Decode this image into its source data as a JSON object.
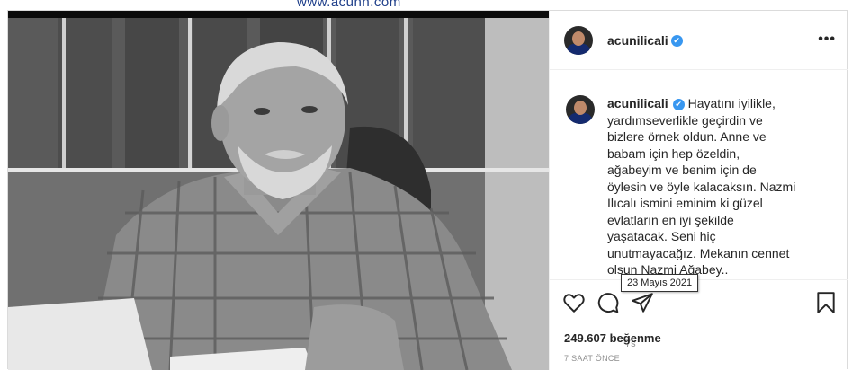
{
  "watermark": "www.acunn.com",
  "post": {
    "author": {
      "username": "acunilicali",
      "verified": true,
      "verified_icon": "verified-badge-icon"
    },
    "more_icon": "more-options-icon",
    "more_label": "•••",
    "caption": "Hayatını iyilikle, yardımseverlikle geçirdin ve bizlere örnek oldun. Anne ve babam için hep özeldin, ağabeyim ve benim için de öylesin ve öyle kalacaksın. Nazmi Ilıcalı ismini eminim ki güzel evlatların en iyi şekilde yaşatacak. Seni hiç unutmayacağız. Mekanın cennet olsun Nazmi Ağabey..",
    "caption_time": "7s",
    "tooltip": "23 Mayıs 2021",
    "likes": "249.607 beğenme",
    "posted_ago": "7 SAAT ÖNCE",
    "icons": {
      "like": "heart-icon",
      "comment": "comment-icon",
      "share": "share-icon",
      "save": "bookmark-icon"
    }
  },
  "colors": {
    "verified": "#3897f0",
    "text": "#262626",
    "muted": "#8e8e8e",
    "border": "#dbdbdb"
  }
}
